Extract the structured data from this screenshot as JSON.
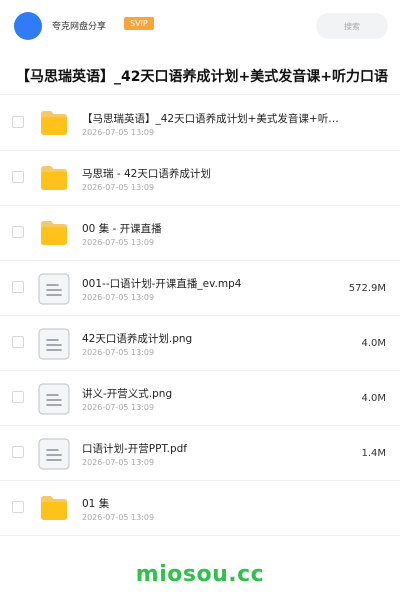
{
  "header": {
    "share_name": "夸克网盘分享",
    "vip_label": "SVIP",
    "search_placeholder": "搜索",
    "colors": {
      "avatar": "#2f7cf6",
      "vip": "#f7a43a"
    }
  },
  "title": "【马思瑞英语】_42天口语养成计划+美式发音课+听力口语",
  "files": [
    {
      "type": "folder",
      "name": "【马思瑞英语】_42天口语养成计划+美式发音课+听…",
      "date": "2026-07-05 13:09",
      "size": ""
    },
    {
      "type": "folder",
      "name": "马思瑞 - 42天口语养成计划",
      "date": "2026-07-05 13:09",
      "size": ""
    },
    {
      "type": "folder",
      "name": "00 集 - 开课直播",
      "date": "2026-07-05 13:09",
      "size": ""
    },
    {
      "type": "file",
      "name": "001--口语计划-开课直播_ev.mp4",
      "date": "2026-07-05 13:09",
      "size": "572.9M"
    },
    {
      "type": "file",
      "name": "42天口语养成计划.png",
      "date": "2026-07-05 13:09",
      "size": "4.0M"
    },
    {
      "type": "file",
      "name": "讲义-开营义式.png",
      "date": "2026-07-05 13:09",
      "size": "4.0M"
    },
    {
      "type": "file",
      "name": "口语计划-开营PPT.pdf",
      "date": "2026-07-05 13:09",
      "size": "1.4M"
    },
    {
      "type": "folder",
      "name": "01 集",
      "date": "2026-07-05 13:09",
      "size": ""
    }
  ],
  "watermark": "miosou.cc",
  "icons": {
    "folder": "folder-icon",
    "file": "document-icon"
  }
}
